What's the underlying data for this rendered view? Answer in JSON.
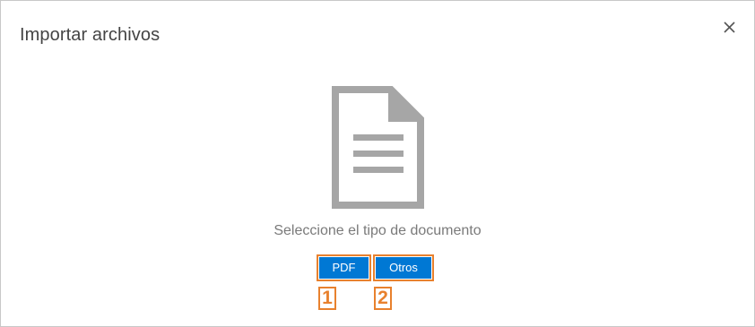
{
  "dialog": {
    "title": "Importar archivos",
    "close_icon": "close-icon"
  },
  "main": {
    "icon": "document-icon",
    "prompt": "Seleccione el tipo de documento",
    "buttons": [
      {
        "label": "PDF"
      },
      {
        "label": "Otros"
      }
    ]
  },
  "annotations": [
    "1",
    "2"
  ],
  "colors": {
    "primary": "#0078d4",
    "highlight": "#e8812e",
    "icon": "#a6a6a6",
    "text_muted": "#7a7a7a"
  }
}
